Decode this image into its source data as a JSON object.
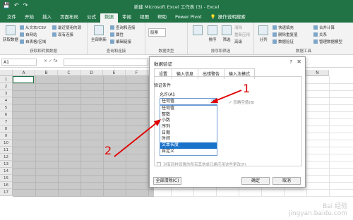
{
  "titlebar": {
    "title": "新建 Microsoft Excel 工作表 (3) - Excel",
    "save": "💾",
    "undo": "↶",
    "redo": "↷"
  },
  "ribbon_tabs": [
    "文件",
    "开始",
    "插入",
    "页面布局",
    "公式",
    "数据",
    "审阅",
    "视图",
    "帮助",
    "Power Pivot"
  ],
  "search_hint": "操作说明搜索",
  "ribbon": {
    "get_data": "获取数据",
    "from_text": "从文本/CSV",
    "from_web": "自网站",
    "from_table": "自表格/区域",
    "recent": "最近使用的源",
    "existing": "现有连接",
    "group1": "获取和转换数据",
    "refresh_all": "全部刷新",
    "queries": "查询和连接",
    "properties": "属性",
    "edit_links": "编辑链接",
    "group2": "查询和连接",
    "stocks": "股票",
    "group3": "数据类型",
    "sort": "排序",
    "filter": "筛选",
    "clear": "清除",
    "reapply": "重新应用",
    "advanced": "高级",
    "group4": "排序和筛选",
    "text_cols": "分列",
    "flash": "快速填充",
    "remove_dup": "删除重复值",
    "validation": "数据验证",
    "consolidate": "合并计算",
    "relations": "关系",
    "manage_model": "管理数据模型",
    "group5": "数据工具"
  },
  "formula_bar": {
    "namebox": "A1",
    "fx": "× ✓ fx"
  },
  "grid": {
    "columns": [
      "A",
      "B",
      "C",
      "D",
      "E",
      "F",
      "G",
      "H",
      "I",
      "J",
      "K",
      "L",
      "M",
      "N"
    ],
    "rows": [
      "1",
      "2",
      "3",
      "4",
      "5",
      "6",
      "7",
      "8",
      "9",
      "10",
      "11",
      "12",
      "13",
      "14",
      "15",
      "16",
      "17"
    ]
  },
  "dialog": {
    "title": "数据验证",
    "help": "?",
    "close": "✕",
    "tabs": [
      "设置",
      "输入信息",
      "出错警告",
      "输入法模式"
    ],
    "section": "验证条件",
    "allow_label": "允许(A):",
    "allow_value": "任何值",
    "ignore_blank": "忽略空值(B)",
    "options": [
      "任何值",
      "整数",
      "小数",
      "序列",
      "日期",
      "时间",
      "文本长度",
      "自定义"
    ],
    "highlighted_option": "文本长度",
    "apply_all": "对有同样设置的所有其他单元格应用这些更改(P)",
    "clear_all": "全部清除(C)",
    "ok": "确定",
    "cancel": "取消"
  },
  "annotations": {
    "one": "1",
    "two": "2"
  },
  "watermark": "Bai 经验\njingyan.baidu.com"
}
